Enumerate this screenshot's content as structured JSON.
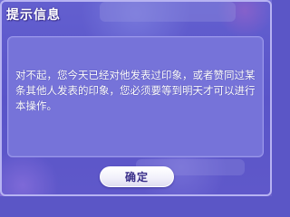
{
  "dialog": {
    "title": "提示信息",
    "message": "对不起，您今天已经对他发表过印象，或者赞同过某条其他人发表的印象，您必须要等到明天才可以进行本操作。",
    "confirm_label": "确定"
  },
  "colors": {
    "dialog_background": "#5652c8",
    "panel_background": "#7673d9",
    "button_text": "#3a2f8a"
  }
}
